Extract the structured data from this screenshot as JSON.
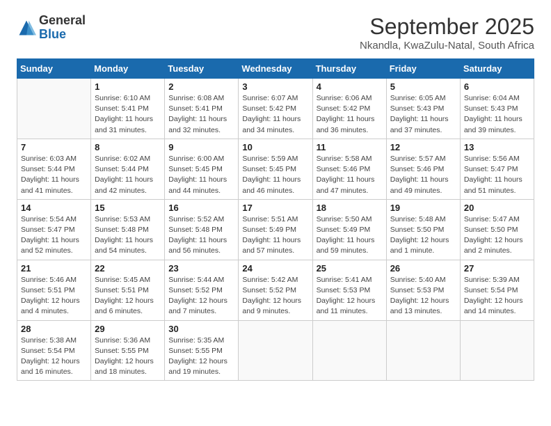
{
  "logo": {
    "general": "General",
    "blue": "Blue"
  },
  "header": {
    "month": "September 2025",
    "location": "Nkandla, KwaZulu-Natal, South Africa"
  },
  "weekdays": [
    "Sunday",
    "Monday",
    "Tuesday",
    "Wednesday",
    "Thursday",
    "Friday",
    "Saturday"
  ],
  "weeks": [
    [
      {
        "num": "",
        "info": ""
      },
      {
        "num": "1",
        "info": "Sunrise: 6:10 AM\nSunset: 5:41 PM\nDaylight: 11 hours\nand 31 minutes."
      },
      {
        "num": "2",
        "info": "Sunrise: 6:08 AM\nSunset: 5:41 PM\nDaylight: 11 hours\nand 32 minutes."
      },
      {
        "num": "3",
        "info": "Sunrise: 6:07 AM\nSunset: 5:42 PM\nDaylight: 11 hours\nand 34 minutes."
      },
      {
        "num": "4",
        "info": "Sunrise: 6:06 AM\nSunset: 5:42 PM\nDaylight: 11 hours\nand 36 minutes."
      },
      {
        "num": "5",
        "info": "Sunrise: 6:05 AM\nSunset: 5:43 PM\nDaylight: 11 hours\nand 37 minutes."
      },
      {
        "num": "6",
        "info": "Sunrise: 6:04 AM\nSunset: 5:43 PM\nDaylight: 11 hours\nand 39 minutes."
      }
    ],
    [
      {
        "num": "7",
        "info": "Sunrise: 6:03 AM\nSunset: 5:44 PM\nDaylight: 11 hours\nand 41 minutes."
      },
      {
        "num": "8",
        "info": "Sunrise: 6:02 AM\nSunset: 5:44 PM\nDaylight: 11 hours\nand 42 minutes."
      },
      {
        "num": "9",
        "info": "Sunrise: 6:00 AM\nSunset: 5:45 PM\nDaylight: 11 hours\nand 44 minutes."
      },
      {
        "num": "10",
        "info": "Sunrise: 5:59 AM\nSunset: 5:45 PM\nDaylight: 11 hours\nand 46 minutes."
      },
      {
        "num": "11",
        "info": "Sunrise: 5:58 AM\nSunset: 5:46 PM\nDaylight: 11 hours\nand 47 minutes."
      },
      {
        "num": "12",
        "info": "Sunrise: 5:57 AM\nSunset: 5:46 PM\nDaylight: 11 hours\nand 49 minutes."
      },
      {
        "num": "13",
        "info": "Sunrise: 5:56 AM\nSunset: 5:47 PM\nDaylight: 11 hours\nand 51 minutes."
      }
    ],
    [
      {
        "num": "14",
        "info": "Sunrise: 5:54 AM\nSunset: 5:47 PM\nDaylight: 11 hours\nand 52 minutes."
      },
      {
        "num": "15",
        "info": "Sunrise: 5:53 AM\nSunset: 5:48 PM\nDaylight: 11 hours\nand 54 minutes."
      },
      {
        "num": "16",
        "info": "Sunrise: 5:52 AM\nSunset: 5:48 PM\nDaylight: 11 hours\nand 56 minutes."
      },
      {
        "num": "17",
        "info": "Sunrise: 5:51 AM\nSunset: 5:49 PM\nDaylight: 11 hours\nand 57 minutes."
      },
      {
        "num": "18",
        "info": "Sunrise: 5:50 AM\nSunset: 5:49 PM\nDaylight: 11 hours\nand 59 minutes."
      },
      {
        "num": "19",
        "info": "Sunrise: 5:48 AM\nSunset: 5:50 PM\nDaylight: 12 hours\nand 1 minute."
      },
      {
        "num": "20",
        "info": "Sunrise: 5:47 AM\nSunset: 5:50 PM\nDaylight: 12 hours\nand 2 minutes."
      }
    ],
    [
      {
        "num": "21",
        "info": "Sunrise: 5:46 AM\nSunset: 5:51 PM\nDaylight: 12 hours\nand 4 minutes."
      },
      {
        "num": "22",
        "info": "Sunrise: 5:45 AM\nSunset: 5:51 PM\nDaylight: 12 hours\nand 6 minutes."
      },
      {
        "num": "23",
        "info": "Sunrise: 5:44 AM\nSunset: 5:52 PM\nDaylight: 12 hours\nand 7 minutes."
      },
      {
        "num": "24",
        "info": "Sunrise: 5:42 AM\nSunset: 5:52 PM\nDaylight: 12 hours\nand 9 minutes."
      },
      {
        "num": "25",
        "info": "Sunrise: 5:41 AM\nSunset: 5:53 PM\nDaylight: 12 hours\nand 11 minutes."
      },
      {
        "num": "26",
        "info": "Sunrise: 5:40 AM\nSunset: 5:53 PM\nDaylight: 12 hours\nand 13 minutes."
      },
      {
        "num": "27",
        "info": "Sunrise: 5:39 AM\nSunset: 5:54 PM\nDaylight: 12 hours\nand 14 minutes."
      }
    ],
    [
      {
        "num": "28",
        "info": "Sunrise: 5:38 AM\nSunset: 5:54 PM\nDaylight: 12 hours\nand 16 minutes."
      },
      {
        "num": "29",
        "info": "Sunrise: 5:36 AM\nSunset: 5:55 PM\nDaylight: 12 hours\nand 18 minutes."
      },
      {
        "num": "30",
        "info": "Sunrise: 5:35 AM\nSunset: 5:55 PM\nDaylight: 12 hours\nand 19 minutes."
      },
      {
        "num": "",
        "info": ""
      },
      {
        "num": "",
        "info": ""
      },
      {
        "num": "",
        "info": ""
      },
      {
        "num": "",
        "info": ""
      }
    ]
  ]
}
